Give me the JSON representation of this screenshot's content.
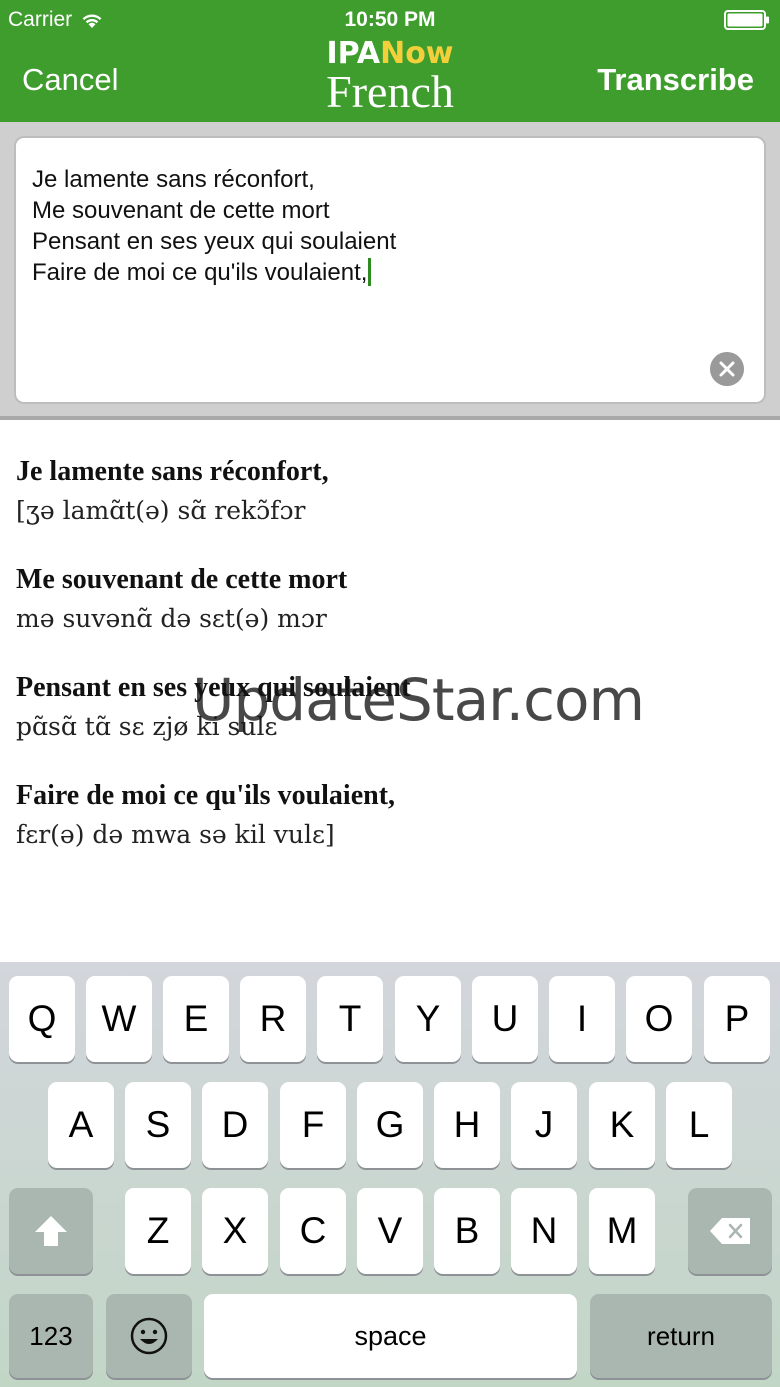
{
  "status": {
    "carrier": "Carrier",
    "time": "10:50 PM"
  },
  "nav": {
    "cancel_label": "Cancel",
    "transcribe_label": "Transcribe",
    "logo_ipa": "IPA",
    "logo_now": "Now",
    "logo_language": "French"
  },
  "input": {
    "lines": [
      "Je lamente sans réconfort,",
      "Me souvenant de cette mort",
      "Pensant en ses yeux qui soulaient",
      "Faire de moi ce qu'ils voulaient,"
    ]
  },
  "results": [
    {
      "original": "Je lamente sans réconfort,",
      "ipa": "[ʒə lamɑ̃t(ə) sɑ̃ rekɔ̃fɔr"
    },
    {
      "original": "Me souvenant de cette mort",
      "ipa": "mə suvənɑ̃ də sɛt(ə) mɔr"
    },
    {
      "original": "Pensant en ses yeux qui soulaient",
      "ipa": "pɑ̃sɑ̃ tɑ̃ sɛ zjø ki sulɛ"
    },
    {
      "original": "Faire de moi ce qu'ils voulaient,",
      "ipa": "fɛr(ə) də mwa sə kil vulɛ]"
    }
  ],
  "watermark": "UpdateStar.com",
  "keyboard": {
    "row1": [
      "Q",
      "W",
      "E",
      "R",
      "T",
      "Y",
      "U",
      "I",
      "O",
      "P"
    ],
    "row2": [
      "A",
      "S",
      "D",
      "F",
      "G",
      "H",
      "J",
      "K",
      "L"
    ],
    "row3": [
      "Z",
      "X",
      "C",
      "V",
      "B",
      "N",
      "M"
    ],
    "numbers_label": "123",
    "space_label": "space",
    "return_label": "return"
  },
  "colors": {
    "nav_bg": "#3f9d2d",
    "logo_now": "#f3cf3a",
    "caret": "#2e8b1f"
  }
}
